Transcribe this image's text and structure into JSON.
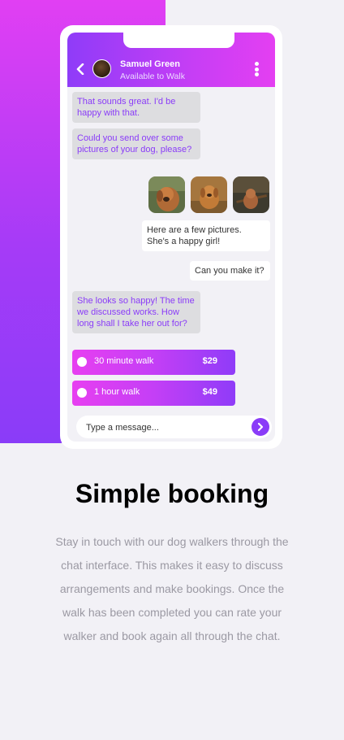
{
  "colors": {
    "accent": "#8a3cf8",
    "accent_pink": "#e43ff2",
    "page_bg": "#f2f1f6",
    "bubble_in_bg": "#dddde0",
    "text_muted": "#9b99a3"
  },
  "chat": {
    "header": {
      "back_icon": "chevron-left-icon",
      "name": "Samuel Green",
      "status": "Available to Walk",
      "menu_icon": "vertical-dots-icon"
    },
    "messages": [
      {
        "from": "walker",
        "text": "That sounds great. I'd be happy with that."
      },
      {
        "from": "walker",
        "text": "Could you send over some pictures of your dog, please?"
      },
      {
        "from": "user",
        "type": "photos",
        "photos": [
          "dog-photo-1",
          "dog-photo-2",
          "dog-photo-3"
        ]
      },
      {
        "from": "user",
        "text": "Here are a few pictures. She's a happy girl!"
      },
      {
        "from": "user",
        "text": "Can you make it?"
      },
      {
        "from": "walker",
        "text": "She looks so happy! The time we discussed works. How long shall I take her out for?"
      }
    ],
    "options": [
      {
        "label": "30 minute walk",
        "price": "$29"
      },
      {
        "label": "1 hour walk",
        "price": "$49"
      }
    ],
    "composer": {
      "placeholder": "Type a message...",
      "send_icon": "arrow-right-icon"
    }
  },
  "section": {
    "title": "Simple booking",
    "description": "Stay in touch with our dog walkers through the chat interface. This makes it easy to discuss arrangements and make bookings. Once the walk has been completed you can rate your walker and book again all through the chat."
  }
}
